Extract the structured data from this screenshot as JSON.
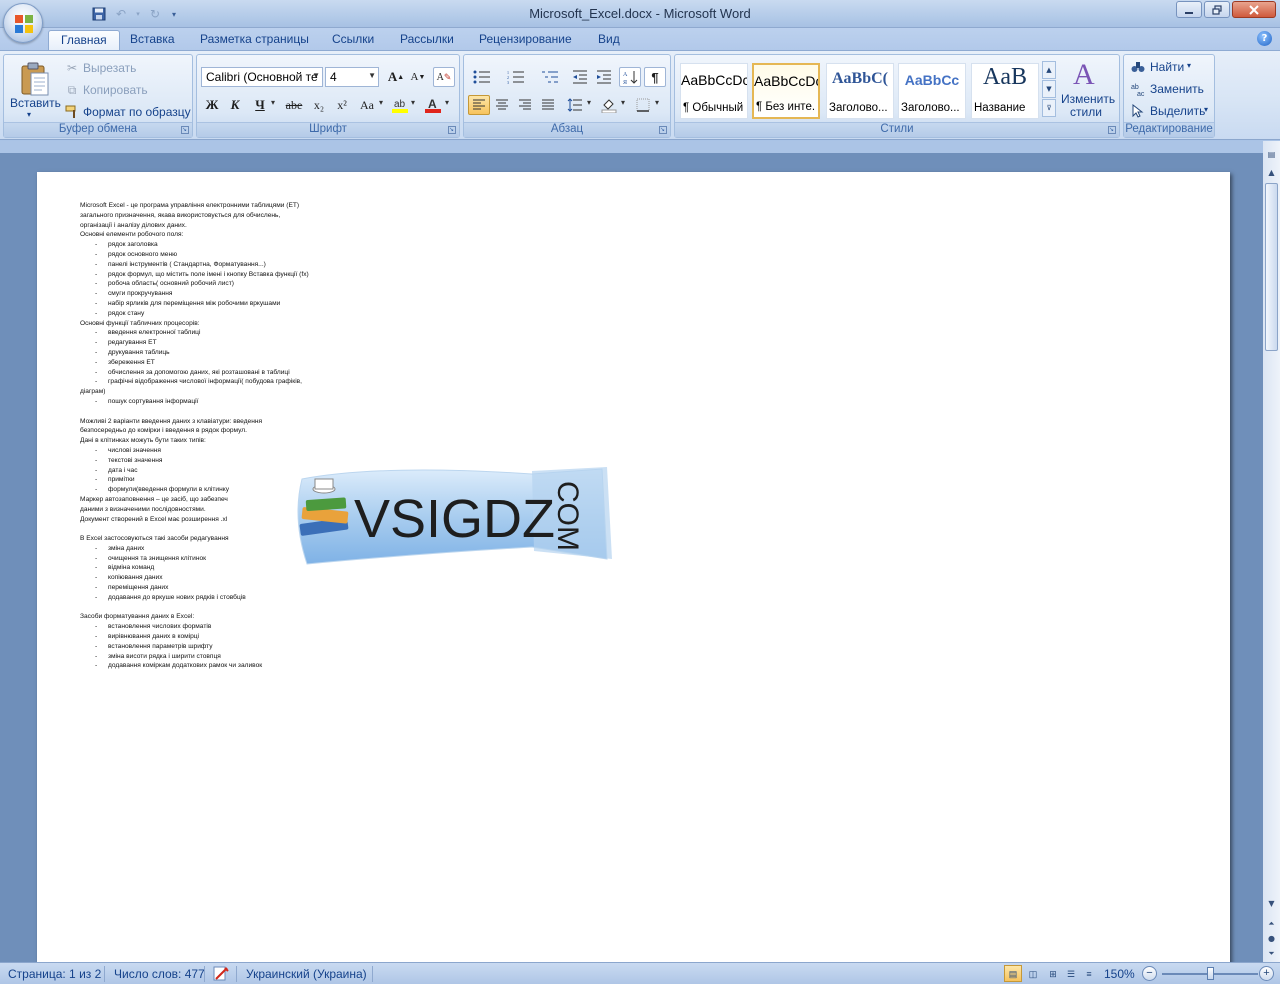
{
  "window": {
    "title": "Microsoft_Excel.docx - Microsoft Word",
    "controls": [
      "minimize",
      "maximize",
      "close"
    ]
  },
  "tabs": [
    "Главная",
    "Вставка",
    "Разметка страницы",
    "Ссылки",
    "Рассылки",
    "Рецензирование",
    "Вид"
  ],
  "active_tab": "Главная",
  "ribbon": {
    "clipboard": {
      "label": "Буфер обмена",
      "paste": "Вставить",
      "cut": "Вырезать",
      "copy": "Копировать",
      "format_painter": "Формат по образцу"
    },
    "font": {
      "label": "Шрифт",
      "font_name": "Calibri (Основной те",
      "font_size": "4",
      "bold": "Ж",
      "italic": "К",
      "underline": "Ч",
      "strike": "abe",
      "sub": "x₂",
      "sup": "x²",
      "case": "Aa"
    },
    "paragraph": {
      "label": "Абзац"
    },
    "styles": {
      "label": "Стили",
      "items": [
        {
          "preview": "AaBbCcDc",
          "name": "¶ Обычный"
        },
        {
          "preview": "AaBbCcDc",
          "name": "¶ Без инте..."
        },
        {
          "preview": "AaBbC(",
          "name": "Заголово..."
        },
        {
          "preview": "AaBbCc",
          "name": "Заголово..."
        },
        {
          "preview": "AaB",
          "name": "Название"
        }
      ],
      "change_styles": "Изменить стили"
    },
    "editing": {
      "label": "Редактирование",
      "find": "Найти",
      "replace": "Заменить",
      "select": "Выделить"
    }
  },
  "document": {
    "paragraphs": [
      {
        "type": "p",
        "text": "Microsoft Excel - це програма управління електронними таблицями (ЕТ)"
      },
      {
        "type": "p",
        "text": "загального призначення, якава використовується для обчислень,"
      },
      {
        "type": "p",
        "text": "організації і аналізу ділових даних."
      },
      {
        "type": "p",
        "text": "Основні елементи робочого поля:"
      },
      {
        "type": "li",
        "text": "рядок  заголовка"
      },
      {
        "type": "li",
        "text": "рядок основного меню"
      },
      {
        "type": "li",
        "text": "панелі інструментів ( Стандартна, Форматування...)"
      },
      {
        "type": "li",
        "text": "рядок формул, що містить поле імені і кнопку Вставка функції (fx)"
      },
      {
        "type": "li",
        "text": "робоча область( основний  робочий лист)"
      },
      {
        "type": "li",
        "text": "смуги прокручування"
      },
      {
        "type": "li",
        "text": "набір ярликів для переміщення між робочими вркушами"
      },
      {
        "type": "li",
        "text": "рядок стану"
      },
      {
        "type": "p",
        "text": "Основні функції табличних процесорів:"
      },
      {
        "type": "li",
        "text": "введення електронної таблиці"
      },
      {
        "type": "li",
        "text": "редагування ЕТ"
      },
      {
        "type": "li",
        "text": "друкування таблиць"
      },
      {
        "type": "li",
        "text": "збереження ЕТ"
      },
      {
        "type": "li",
        "text": "обчислення за допомогою даних, які розташовані в таблиці"
      },
      {
        "type": "li",
        "text": "графічні відображення числової інформації( побудова графіків,"
      },
      {
        "type": "p",
        "text": "діаграм)"
      },
      {
        "type": "li",
        "text": "пошук сортування інформації"
      },
      {
        "type": "gap",
        "text": ""
      },
      {
        "type": "p",
        "text": "Можливі 2 варіанти введення даних з клавіатури: введення"
      },
      {
        "type": "p",
        "text": "безпосередньо до комірки і введення в рядок формул."
      },
      {
        "type": "p",
        "text": "Дані в клітинках можуть бути таких типів:"
      },
      {
        "type": "li",
        "text": "числові значення"
      },
      {
        "type": "li",
        "text": "текстові значення"
      },
      {
        "type": "li",
        "text": "дата і час"
      },
      {
        "type": "li",
        "text": "примітки"
      },
      {
        "type": "li",
        "text": "формули(введення формули в клітинку"
      },
      {
        "type": "p",
        "text": "Маркер автозаповнення – це засіб, що забезпеч"
      },
      {
        "type": "p",
        "text": "даними з визначеними послідовностями."
      },
      {
        "type": "p",
        "text": "Документ створений в Excel має розширення .xl"
      },
      {
        "type": "gap",
        "text": ""
      },
      {
        "type": "p",
        "text": "В Excel застосовуються такі засоби редагування"
      },
      {
        "type": "li",
        "text": "зміна даних"
      },
      {
        "type": "li",
        "text": "очищення та знищення клітинок"
      },
      {
        "type": "li",
        "text": "відміна команд"
      },
      {
        "type": "li",
        "text": "копіювання даних"
      },
      {
        "type": "li",
        "text": "переміщення даних"
      },
      {
        "type": "li",
        "text": "додавання до вркуше нових рядків і стовбців"
      },
      {
        "type": "gap",
        "text": ""
      },
      {
        "type": "p",
        "text": "Засоби форматування даних в Excel:"
      },
      {
        "type": "li",
        "text": "встановлення числових форматів"
      },
      {
        "type": "li",
        "text": "вирівнювання даних в комірці"
      },
      {
        "type": "li",
        "text": "встановлення параметрів шрифту"
      },
      {
        "type": "li",
        "text": "зміна висоти рядка і ширити стовпця"
      },
      {
        "type": "li",
        "text": "додавання коміркам додаткових рамок чи заливок"
      }
    ],
    "watermark": {
      "text": "VSIGDZ",
      "suffix": "COM"
    }
  },
  "status": {
    "page": "Страница: 1 из 2",
    "words": "Число слов: 477",
    "language": "Украинский (Украина)",
    "zoom": "150%",
    "zoom_level": 0.5
  }
}
